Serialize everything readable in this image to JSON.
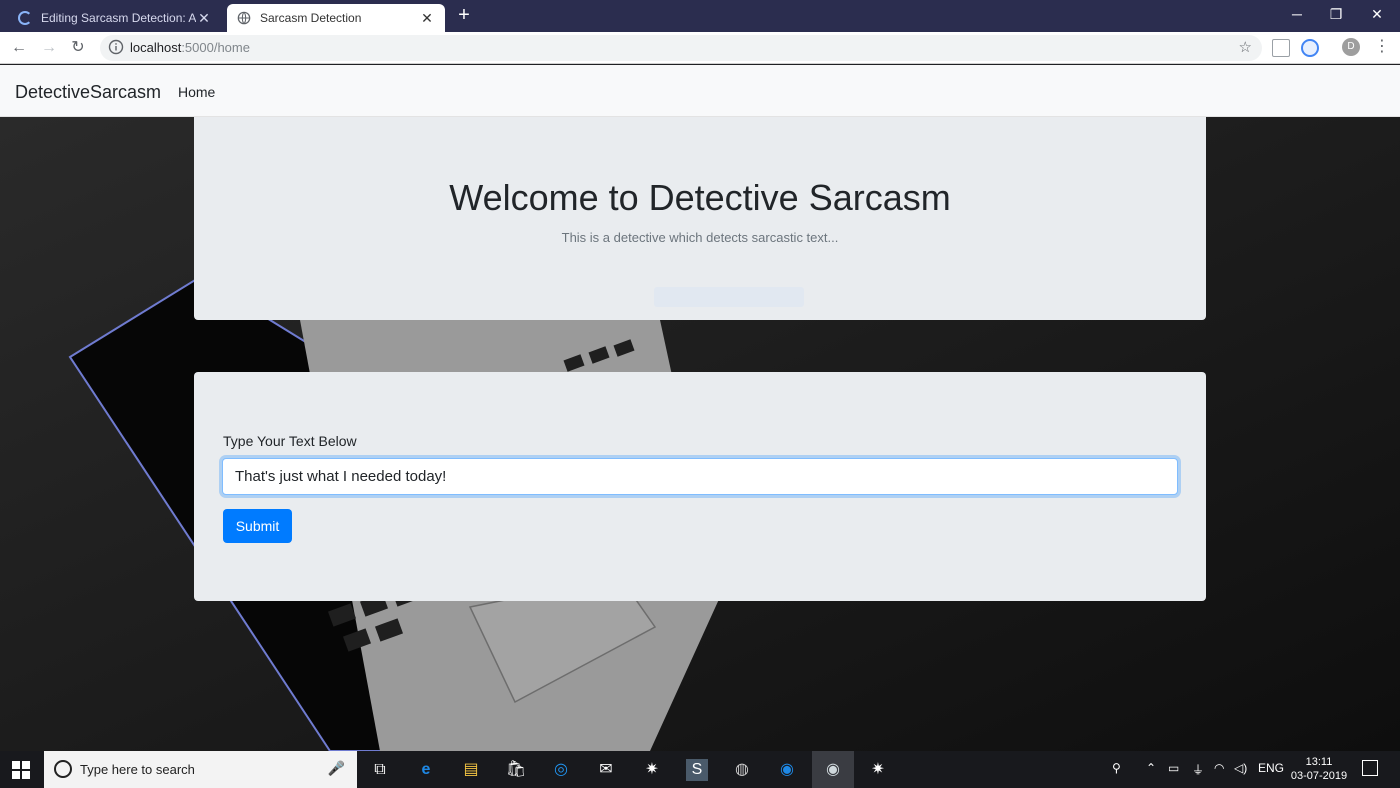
{
  "browser": {
    "tabs": [
      {
        "title": "Editing Sarcasm Detection: An a",
        "active": false
      },
      {
        "title": "Sarcasm Detection",
        "active": true
      }
    ],
    "url_host": "localhost",
    "url_path": ":5000/home",
    "profile_initial": "D"
  },
  "navbar": {
    "brand": "DetectiveSarcasm",
    "links": [
      "Home"
    ]
  },
  "jumbotron": {
    "title": "Welcome to Detective Sarcasm",
    "subtitle": "This is a detective which detects sarcastic text..."
  },
  "form": {
    "label": "Type Your Text Below",
    "input_value": "That's just what I needed today!",
    "submit_label": "Submit"
  },
  "taskbar": {
    "search_placeholder": "Type here to search",
    "language": "ENG",
    "time": "13:11",
    "date": "03-07-2019"
  },
  "colors": {
    "primary": "#007bff",
    "tabstrip": "#2b2d4f",
    "card_bg": "#e9ecef"
  }
}
